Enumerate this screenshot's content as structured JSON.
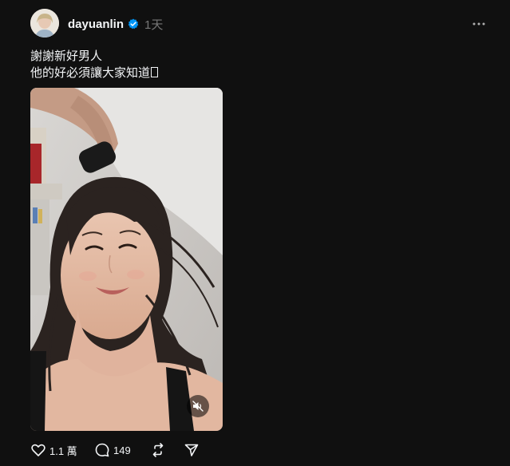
{
  "post": {
    "username": "dayuanlin",
    "verified_icon": "verified-badge-icon",
    "timestamp": "1天",
    "caption_lines": [
      "謝謝新好男人",
      "他的好必須讓大家知道"
    ],
    "media": {
      "type": "video",
      "mute_icon": "volume-muted-icon"
    },
    "actions": {
      "like_count": "1.1 萬",
      "comment_count": "149",
      "repost_icon": "repost-icon",
      "share_icon": "share-icon"
    }
  },
  "colors": {
    "background": "#101010",
    "text_primary": "#f3f5f7",
    "text_secondary": "#777777",
    "verified_blue": "#0095f6"
  }
}
